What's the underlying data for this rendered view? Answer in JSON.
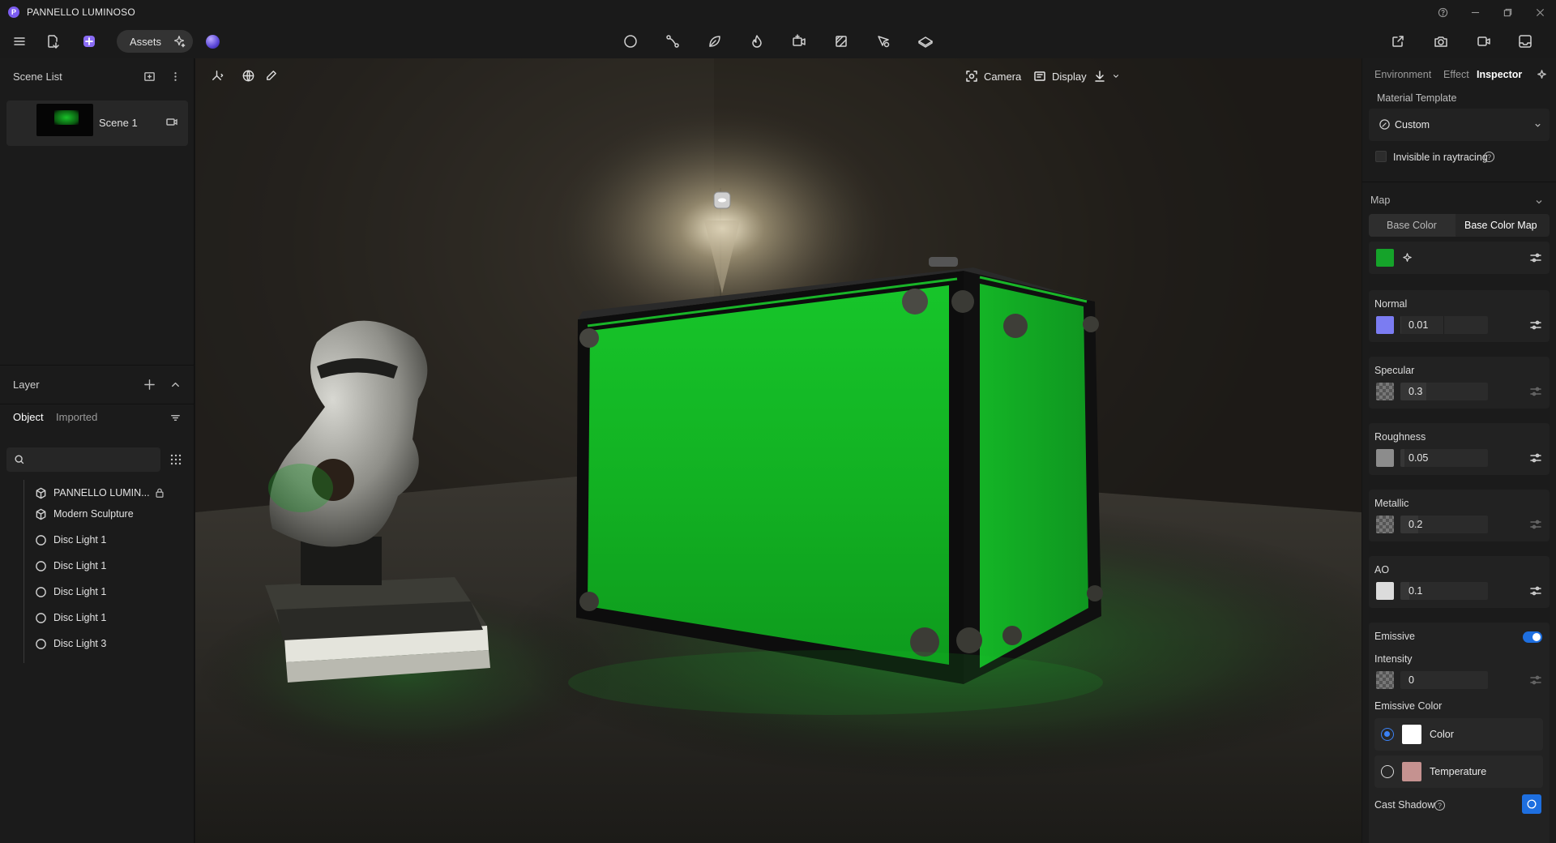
{
  "window": {
    "title": "PANNELLO LUMINOSO",
    "logo_letter": "P",
    "controls": [
      "?",
      "–",
      "❐",
      "✕"
    ]
  },
  "toolbar": {
    "assets_label": "Assets",
    "center_tools": [
      "sphere-icon",
      "path-icon",
      "leaf-icon",
      "fire-icon",
      "camera-add-icon",
      "material-icon",
      "cursor-icon",
      "plane-icon"
    ],
    "right_tools": [
      "share-icon",
      "camera-icon",
      "video-icon",
      "export-icon"
    ]
  },
  "scene_list": {
    "title": "Scene List",
    "scenes": [
      {
        "name": "Scene 1"
      }
    ]
  },
  "layer": {
    "title": "Layer",
    "tabs": {
      "object": "Object",
      "imported": "Imported"
    },
    "search_placeholder": "",
    "items": [
      {
        "name": "PANNELLO LUMIN...",
        "icon": "cube-icon",
        "locked": true
      },
      {
        "name": "Modern Sculpture",
        "icon": "cube-icon"
      },
      {
        "name": "Disc Light 1",
        "icon": "circle-icon"
      },
      {
        "name": "Disc Light 1",
        "icon": "circle-icon"
      },
      {
        "name": "Disc Light 1",
        "icon": "circle-icon"
      },
      {
        "name": "Disc Light 1",
        "icon": "circle-icon"
      },
      {
        "name": "Disc Light 3",
        "icon": "circle-icon"
      }
    ]
  },
  "viewport": {
    "camera_label": "Camera",
    "display_label": "Display",
    "glow_color": "#19d32a"
  },
  "inspector": {
    "tabs": {
      "environment": "Environment",
      "effect": "Effect",
      "inspector": "Inspector"
    },
    "material_template_label": "Material Template",
    "material_template_value": "Custom",
    "invisible_label": "Invisible in raytracing",
    "map_label": "Map",
    "map_tabs": {
      "base_color": "Base Color",
      "base_color_map": "Base Color Map"
    },
    "base_color": "#15a32a",
    "normal": {
      "label": "Normal",
      "value": "0.01",
      "color": "#7b7cf2",
      "level": 0.01
    },
    "specular": {
      "label": "Specular",
      "value": "0.3",
      "level": 0.3
    },
    "roughness": {
      "label": "Roughness",
      "value": "0.05",
      "level": 0.05
    },
    "metallic": {
      "label": "Metallic",
      "value": "0.2",
      "level": 0.2
    },
    "ao": {
      "label": "AO",
      "value": "0.1",
      "level": 0.1
    },
    "emissive_label": "Emissive",
    "emissive_on": true,
    "intensity": {
      "label": "Intensity",
      "value": "0",
      "level": 0
    },
    "emissive_color_label": "Emissive Color",
    "color_option": "Color",
    "temperature_option": "Temperature",
    "temperature_color": "#c59290",
    "cast_shadow_label": "Cast Shadow"
  }
}
